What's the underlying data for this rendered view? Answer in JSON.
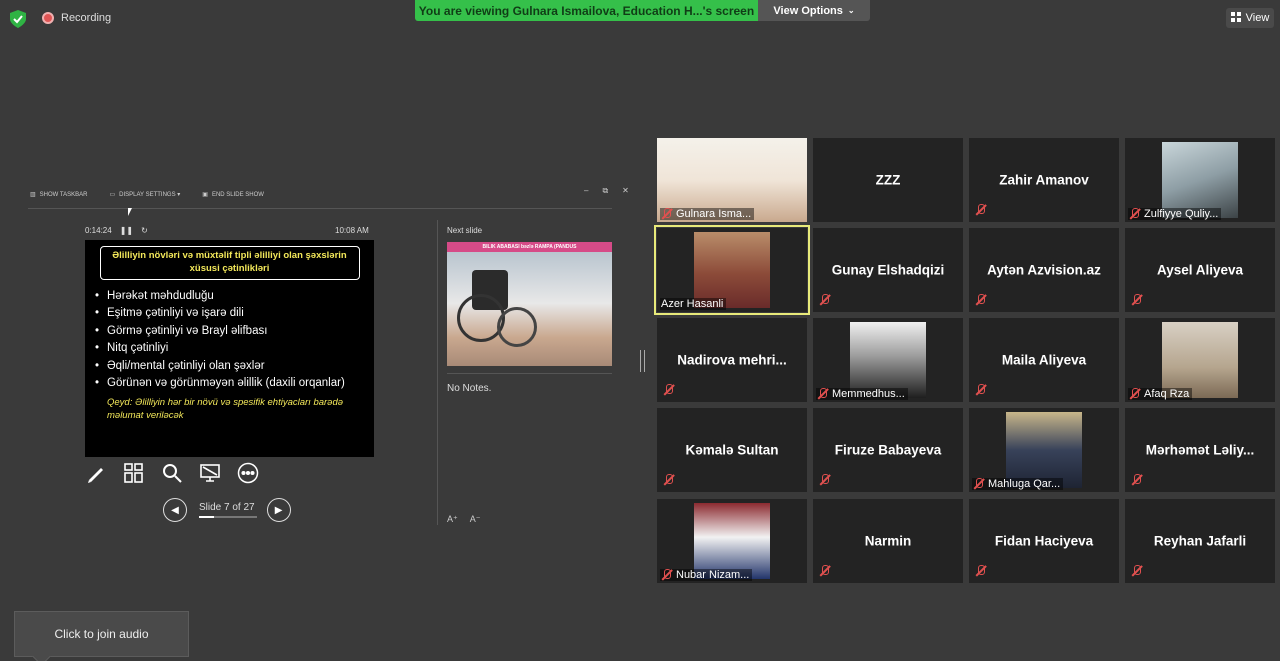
{
  "topbar": {
    "recording_label": "Recording",
    "banner": "You are viewing Gulnara Ismailova, Education H...'s screen",
    "view_options": "View Options",
    "view": "View"
  },
  "presenter": {
    "tools": {
      "show_taskbar": "SHOW TASKBAR",
      "display_settings": "DISPLAY SETTINGS ▾",
      "end_show": "END SLIDE SHOW"
    },
    "timer": "0:14:24",
    "clock": "10:08 AM",
    "slide": {
      "title": "Əlilliyin növləri və müxtəlif tipli əlilliyi olan şəxslərin xüsusi çətinlikləri",
      "bullets": [
        "Hərəkət məhdudluğu",
        "Eşitmə çətinliyi və işarə dili",
        "Görmə çətinliyi və Brayl əlifbası",
        "Nitq çətinliyi",
        "Əqli/mental çətinliyi olan şəxlər",
        "Görünən və görünməyən əlillik (daxili orqanlar)"
      ],
      "note": "Qeyd: Əlilliyin hər bir növü və spesifik ehtiyacları barədə məlumat veriləcək"
    },
    "slide_counter": "Slide 7 of 27",
    "progress": 0.26,
    "next_slide_label": "Next slide",
    "next_slide_header": "BILIK ABABASI bəzlə RAMPA (PANDUS",
    "no_notes": "No Notes."
  },
  "participants": [
    {
      "name": "Gulnara Isma...",
      "video": true,
      "muted": true
    },
    {
      "name": "ZZZ",
      "video": false,
      "muted": false
    },
    {
      "name": "Zahir Amanov",
      "video": false,
      "muted": true
    },
    {
      "name": "Zulfiyye Quliy...",
      "video": true,
      "muted": true
    },
    {
      "name": "Azer Hasanli",
      "video": true,
      "muted": false,
      "active": true
    },
    {
      "name": "Gunay Elshadqizi",
      "video": false,
      "muted": true
    },
    {
      "name": "Aytən Azvision.az",
      "video": false,
      "muted": true
    },
    {
      "name": "Aysel Aliyeva",
      "video": false,
      "muted": true
    },
    {
      "name": "Nadirova  mehri...",
      "video": false,
      "muted": true
    },
    {
      "name": "Memmedhus...",
      "video": true,
      "muted": true
    },
    {
      "name": "Maila Aliyeva",
      "video": false,
      "muted": true
    },
    {
      "name": "Afaq Rza",
      "video": true,
      "muted": true
    },
    {
      "name": "Kəmalə Sultan",
      "video": false,
      "muted": true
    },
    {
      "name": "Firuze Babayeva",
      "video": false,
      "muted": true
    },
    {
      "name": "Mahluga Qar...",
      "video": true,
      "muted": true
    },
    {
      "name": "Mərhəmət  Ləlіy...",
      "video": false,
      "muted": true
    },
    {
      "name": "Nubar Nizam...",
      "video": true,
      "muted": true
    },
    {
      "name": "Narmin",
      "video": false,
      "muted": true
    },
    {
      "name": "Fidan Haciyeva",
      "video": false,
      "muted": true
    },
    {
      "name": "Reyhan Jafarli",
      "video": false,
      "muted": true
    }
  ],
  "audio_button": "Click to join audio",
  "colors": {
    "banner": "#35c04a",
    "active_border": "#e8ea7a",
    "muted": "#e0504f"
  }
}
